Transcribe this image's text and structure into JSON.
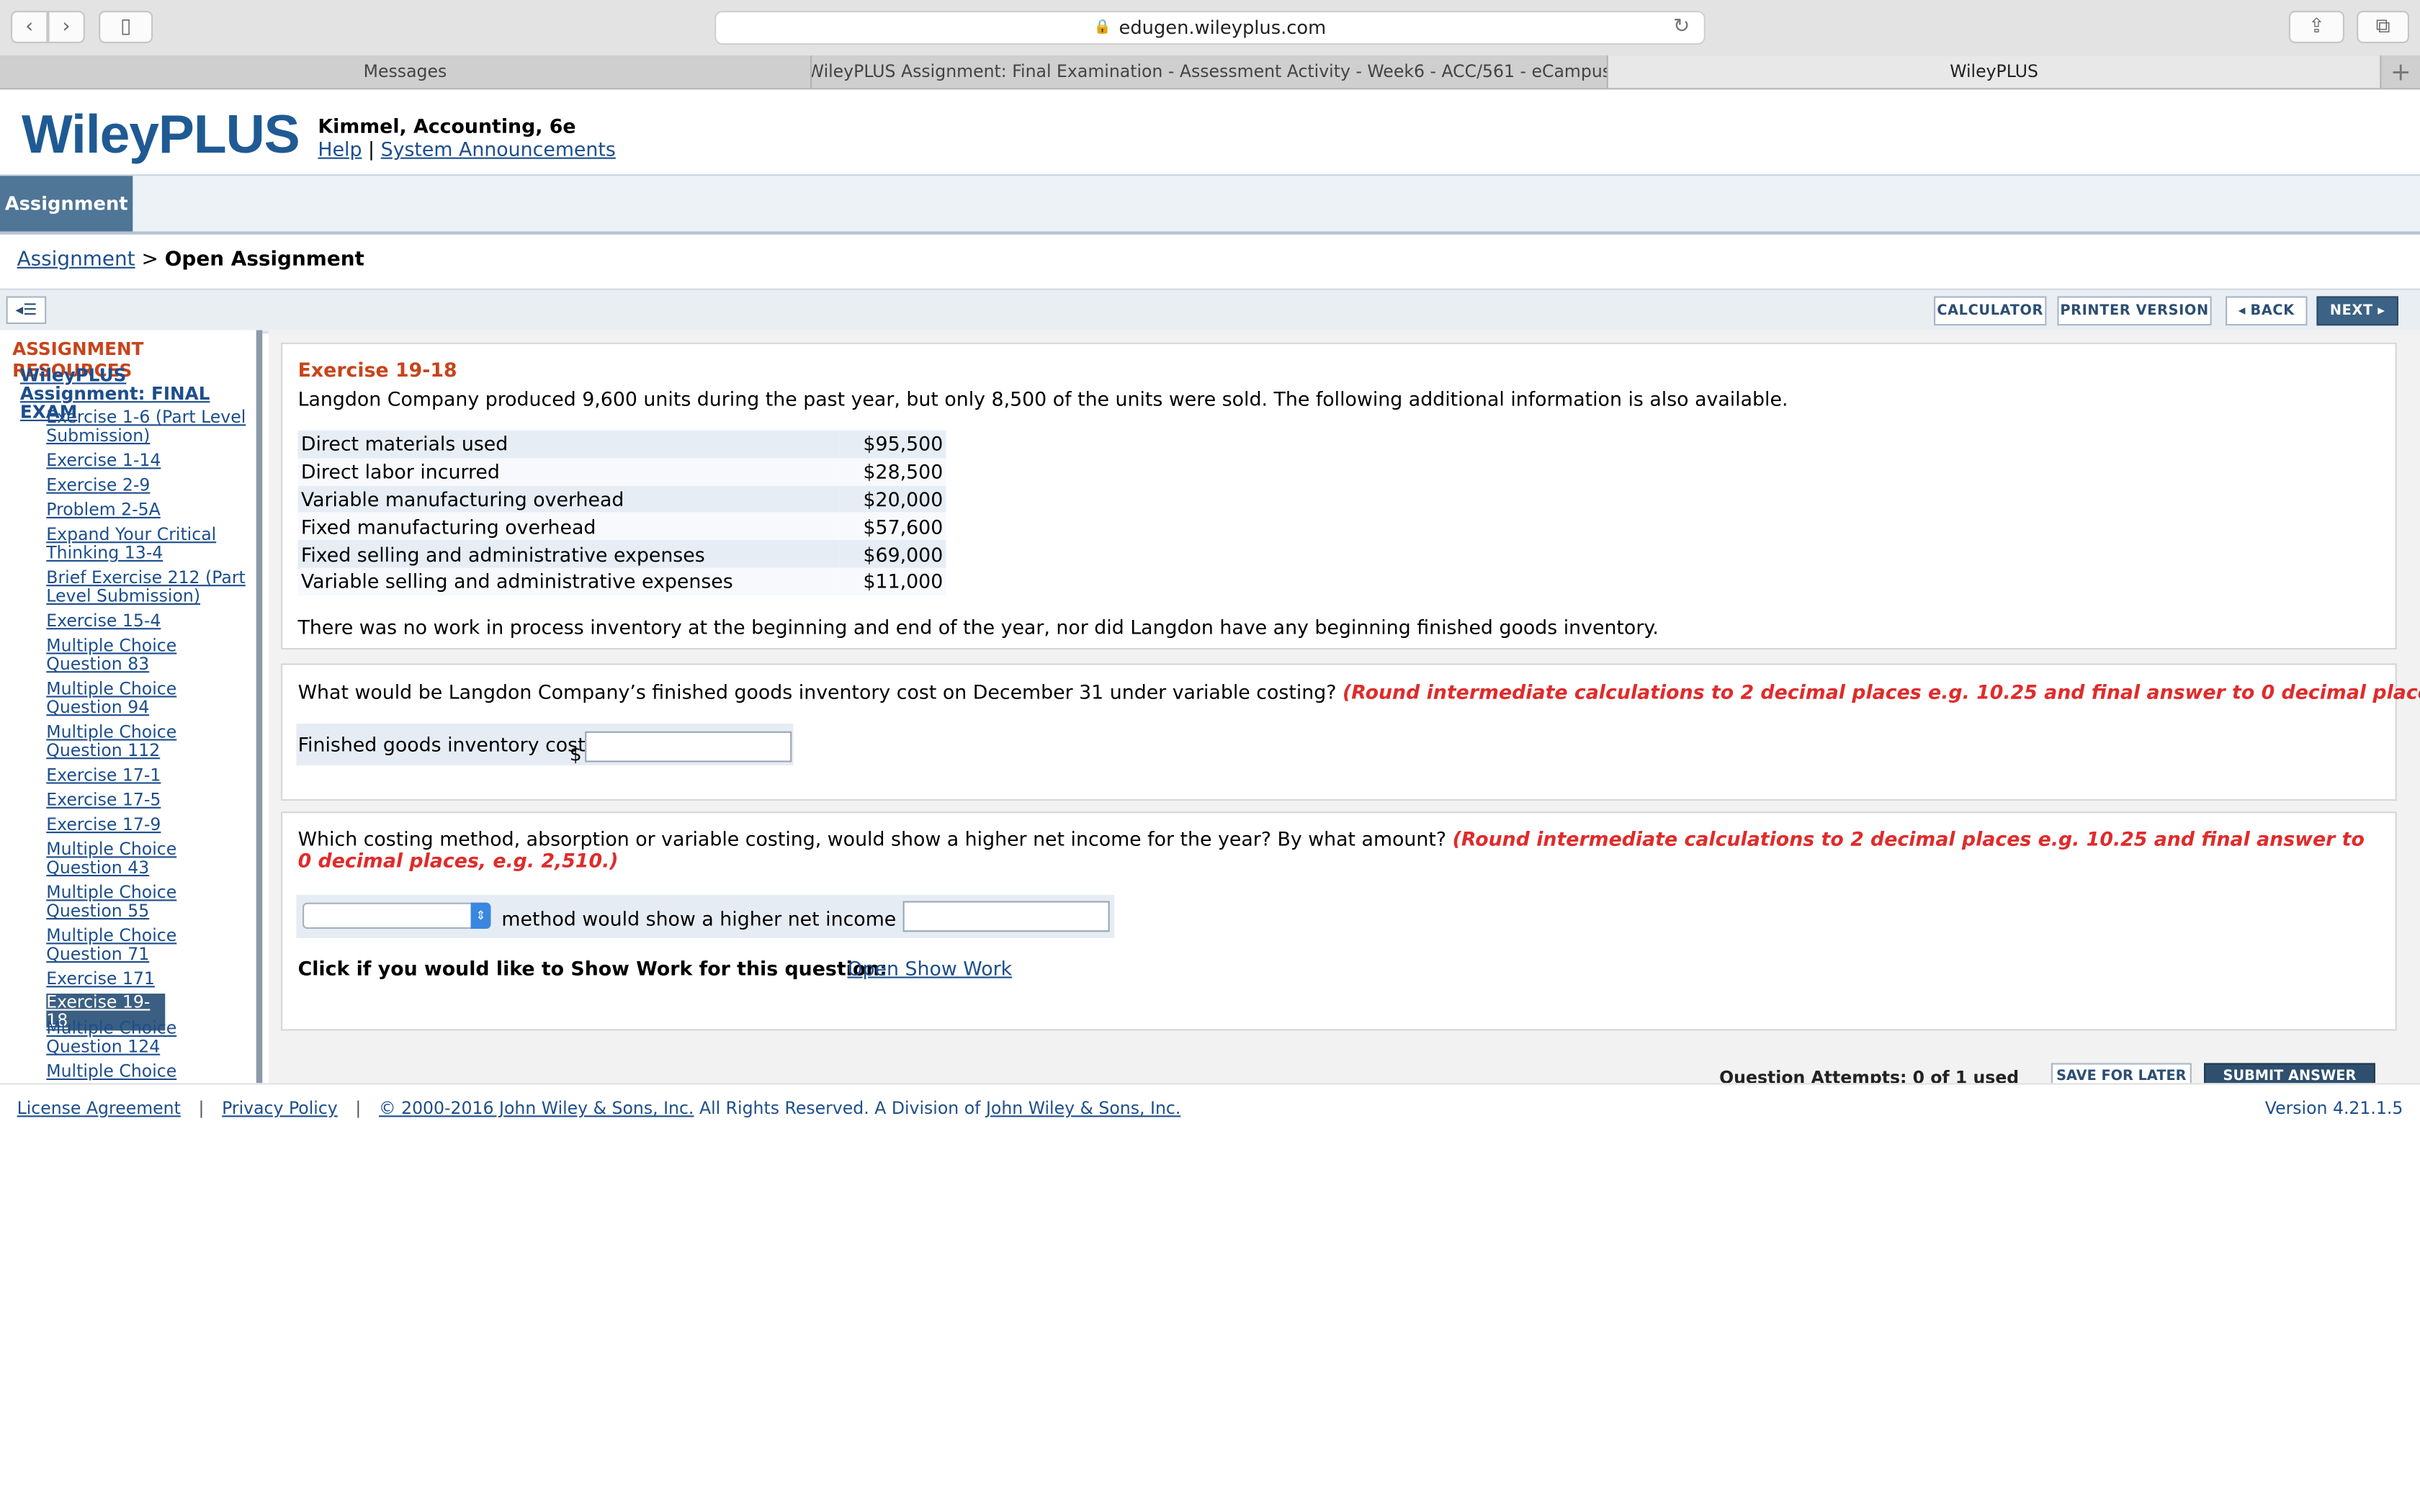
{
  "browser": {
    "url": "edugen.wileyplus.com",
    "tabs": [
      "Messages",
      "WileyPLUS Assignment: Final Examination - Assessment Activity - Week6 - ACC/561 - eCampus",
      "WileyPLUS"
    ],
    "new_tab_glyph": "+"
  },
  "header": {
    "logo": "WileyPLUS",
    "course": "Kimmel, Accounting, 6e",
    "help": "Help",
    "separator": "|",
    "announcements": "System Announcements"
  },
  "nav": {
    "active_tab": "Assignment"
  },
  "breadcrumb": {
    "parent": "Assignment",
    "sep": ">",
    "current": "Open Assignment"
  },
  "toolbar": {
    "calculator": "CALCULATOR",
    "printer": "PRINTER VERSION",
    "back": "BACK",
    "next": "NEXT"
  },
  "sidebar": {
    "heading": "ASSIGNMENT RESOURCES",
    "assignment_title": "WileyPLUS Assignment: FINAL EXAM",
    "items": [
      "Exercise 1-6 (Part Level Submission)",
      "Exercise 1-14",
      "Exercise 2-9",
      "Problem 2-5A",
      "Expand Your Critical Thinking 13-4",
      "Brief Exercise 212 (Part Level Submission)",
      "Exercise 15-4",
      "Multiple Choice Question 83",
      "Multiple Choice Question 94",
      "Multiple Choice Question 112",
      "Exercise 17-1",
      "Exercise 17-5",
      "Exercise 17-9",
      "Multiple Choice Question 43",
      "Multiple Choice Question 55",
      "Multiple Choice Question 71",
      "Exercise 171",
      "Exercise 19-18",
      "Multiple Choice Question 124",
      "Multiple Choice"
    ],
    "selected_index": 17
  },
  "exercise": {
    "title": "Exercise 19-18",
    "intro": "Langdon Company produced 9,600 units during the past year, but only 8,500 of the units were sold. The following additional information is also available.",
    "rows": [
      {
        "label": "Direct materials used",
        "amount": "$95,500"
      },
      {
        "label": "Direct labor incurred",
        "amount": "$28,500"
      },
      {
        "label": "Variable manufacturing overhead",
        "amount": "$20,000"
      },
      {
        "label": "Fixed manufacturing overhead",
        "amount": "$57,600"
      },
      {
        "label": "Fixed selling and administrative expenses",
        "amount": "$69,000"
      },
      {
        "label": "Variable selling and administrative expenses",
        "amount": "$11,000"
      }
    ],
    "note": "There was no work in process inventory at the beginning and end of the year, nor did Langdon have any beginning finished goods inventory."
  },
  "question1": {
    "text": "What would be Langdon Company’s finished goods inventory cost on December 31 under variable costing?",
    "instruction": "(Round intermediate calculations to 2 decimal places e.g. 10.25 and final answer to 0 decimal places, e.g. 2,510.)",
    "label": "Finished goods inventory cost",
    "currency": "$",
    "value": ""
  },
  "question2": {
    "text": "Which costing method, absorption or variable costing, would show a higher net income for the year? By what amount?",
    "instruction": "(Round intermediate calculations to 2 decimal places e.g. 10.25 and final answer to 0 decimal places, e.g. 2,510.)",
    "select_value": "",
    "middle_text": "method would show a higher net income by $",
    "amount_value": "",
    "show_work_prompt": "Click if you would like to Show Work for this question:",
    "show_work_link": "Open Show Work"
  },
  "bottom": {
    "attempts": "Question Attempts: 0 of 1 used",
    "save": "SAVE FOR LATER",
    "submit": "SUBMIT ANSWER"
  },
  "footer": {
    "license": "License Agreement",
    "privacy": "Privacy Policy",
    "copyright_link": "© 2000-2016 John Wiley & Sons, Inc.",
    "rights": "All Rights Reserved. A Division of",
    "company": "John Wiley & Sons, Inc.",
    "version": "Version 4.21.1.5"
  }
}
